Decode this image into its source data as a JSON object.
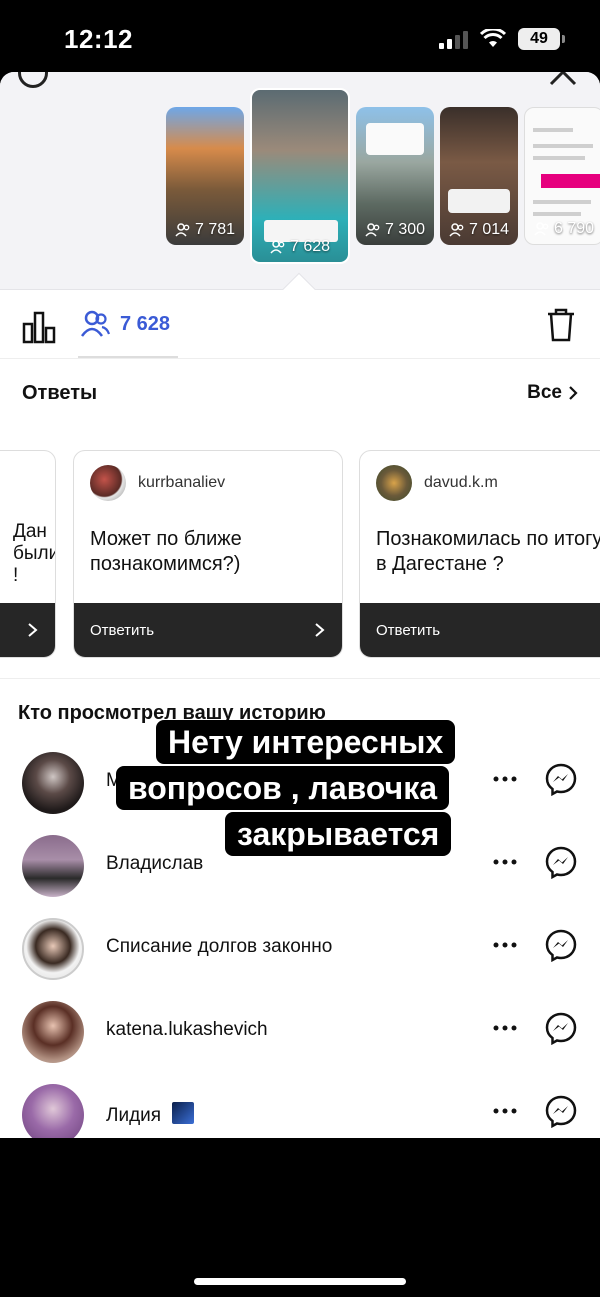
{
  "status": {
    "time": "12:12",
    "battery": "49"
  },
  "stories": [
    {
      "viewers": "7 781"
    },
    {
      "viewers": "7 628"
    },
    {
      "viewers": "7 300"
    },
    {
      "viewers": "7 014"
    },
    {
      "viewers": "6 790"
    }
  ],
  "tabs": {
    "viewers_count": "7 628"
  },
  "answers": {
    "title": "Ответы",
    "all_label": "Все",
    "partial_card": {
      "question": "Дан\nбыли\n!"
    },
    "cards": [
      {
        "username": "kurrbanaliev",
        "question": "Может по ближе познакомимся?)",
        "reply_label": "Ответить"
      },
      {
        "username": "davud.k.m",
        "question": "Познакомилась по итогу в Дагестане ?",
        "reply_label": "Ответить"
      }
    ]
  },
  "viewers": {
    "title": "Кто просмотрел вашу историю",
    "items": [
      {
        "name": "М"
      },
      {
        "name": "Владислав"
      },
      {
        "name": "Списание долгов законно"
      },
      {
        "name": "katena.lukashevich"
      },
      {
        "name": "Лидия"
      }
    ]
  },
  "caption": {
    "line1": "Нету интересных",
    "line2": "вопросов , лавочка",
    "line3": "закрывается"
  },
  "colors": {
    "accent": "#3b5bd6",
    "reply_bar": "#262626",
    "pink": "#e6007e"
  }
}
